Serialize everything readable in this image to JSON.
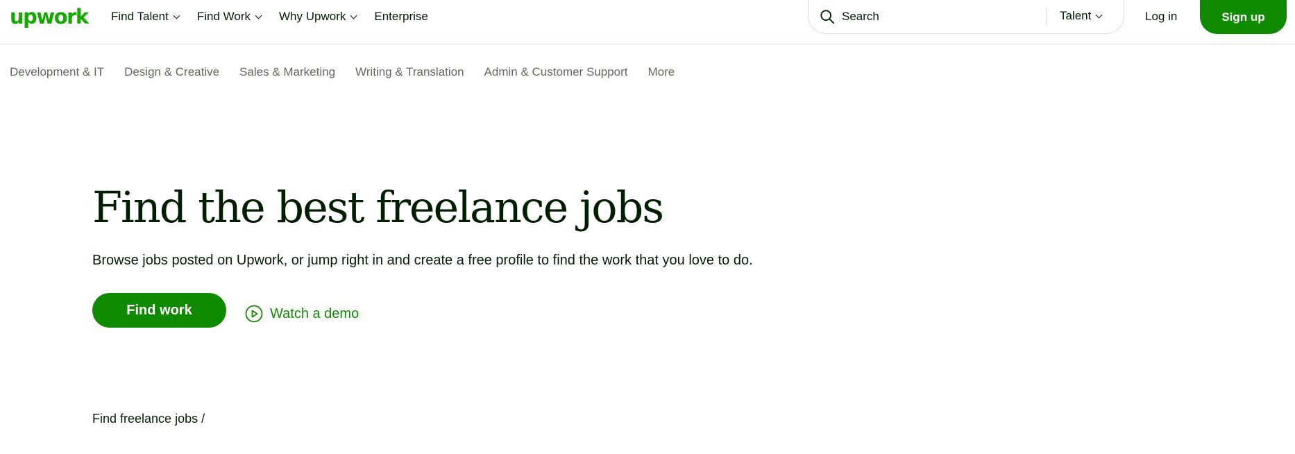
{
  "header": {
    "logo": "upwork",
    "nav": [
      {
        "label": "Find Talent",
        "dropdown": true
      },
      {
        "label": "Find Work",
        "dropdown": true
      },
      {
        "label": "Why Upwork",
        "dropdown": true
      },
      {
        "label": "Enterprise",
        "dropdown": false
      }
    ],
    "search": {
      "placeholder": "Search",
      "scope": "Talent"
    },
    "login_label": "Log in",
    "signup_label": "Sign up"
  },
  "categories": [
    "Development & IT",
    "Design & Creative",
    "Sales & Marketing",
    "Writing & Translation",
    "Admin & Customer Support",
    "More"
  ],
  "hero": {
    "title": "Find the best freelance jobs",
    "subtitle": "Browse jobs posted on Upwork, or jump right in and create a free profile to find the work that you love to do.",
    "primary_cta": "Find work",
    "secondary_cta": "Watch a demo"
  },
  "breadcrumb": "Find freelance jobs /",
  "colors": {
    "brand": "#14a800",
    "button": "#108a00",
    "text": "#001e00",
    "muted": "#5e6d55",
    "border": "#d5e0d5"
  },
  "icons": {
    "search": "search-icon",
    "play": "play-circle-icon",
    "chevron": "chevron-down-icon"
  }
}
